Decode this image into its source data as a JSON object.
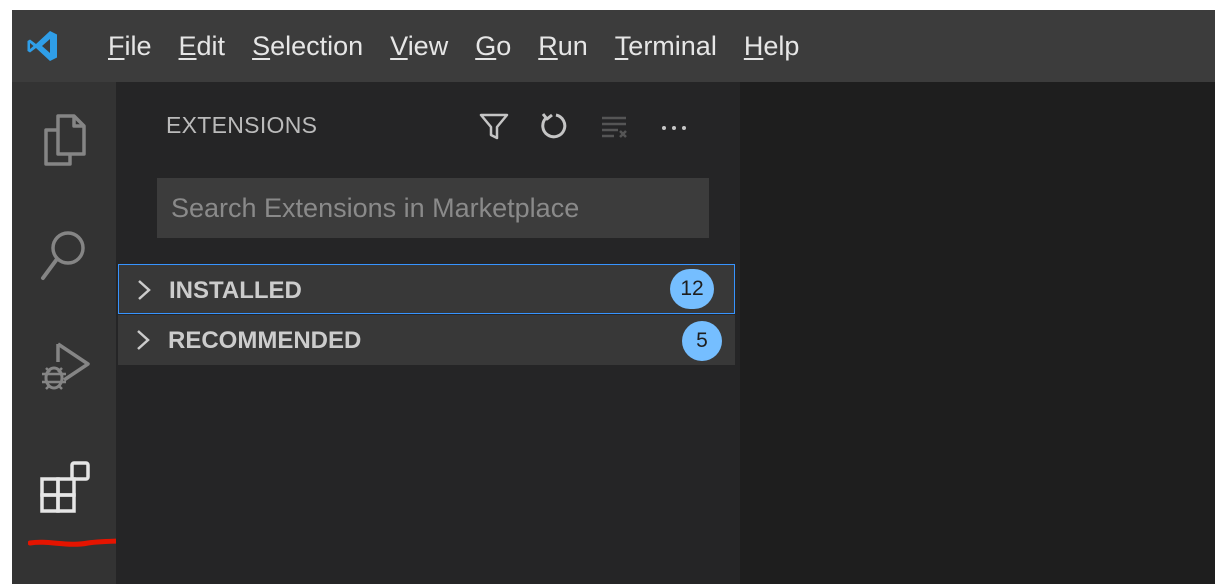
{
  "menu": {
    "items": [
      {
        "mnemonic": "F",
        "rest": "ile"
      },
      {
        "mnemonic": "E",
        "rest": "dit"
      },
      {
        "mnemonic": "S",
        "rest": "election"
      },
      {
        "mnemonic": "V",
        "rest": "iew"
      },
      {
        "mnemonic": "G",
        "rest": "o"
      },
      {
        "mnemonic": "R",
        "rest": "un"
      },
      {
        "mnemonic": "T",
        "rest": "erminal"
      },
      {
        "mnemonic": "H",
        "rest": "elp"
      }
    ]
  },
  "activity_bar": {
    "items": [
      "explorer-icon",
      "search-icon",
      "run-debug-icon",
      "extensions-icon"
    ],
    "active": "extensions-icon"
  },
  "sidebar": {
    "title": "EXTENSIONS",
    "actions": [
      "filter-icon",
      "refresh-icon",
      "clear-icon",
      "more-actions-icon"
    ],
    "search": {
      "placeholder": "Search Extensions in Marketplace",
      "value": ""
    },
    "sections": [
      {
        "label": "INSTALLED",
        "count": "12",
        "expanded": false,
        "focused": true
      },
      {
        "label": "RECOMMENDED",
        "count": "5",
        "expanded": false,
        "focused": false
      }
    ]
  },
  "colors": {
    "accent": "#3794ff",
    "badge": "#75beff",
    "annotation": "#e51400"
  }
}
